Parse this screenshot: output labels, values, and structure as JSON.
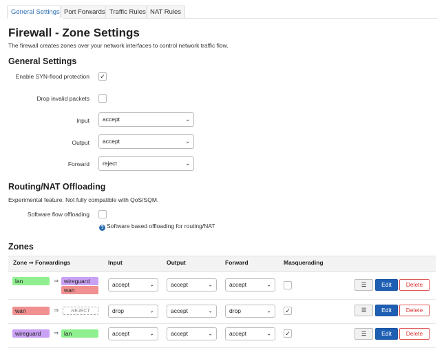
{
  "tabs": [
    {
      "label": "General Settings",
      "active": true
    },
    {
      "label": "Port Forwards",
      "active": false
    },
    {
      "label": "Traffic Rules",
      "active": false
    },
    {
      "label": "NAT Rules",
      "active": false
    }
  ],
  "title": "Firewall - Zone Settings",
  "description": "The firewall creates zones over your network interfaces to control network traffic flow.",
  "general": {
    "heading": "General Settings",
    "syn_label": "Enable SYN-flood protection",
    "syn_checked": true,
    "drop_label": "Drop invalid packets",
    "drop_checked": false,
    "input_label": "Input",
    "input_value": "accept",
    "output_label": "Output",
    "output_value": "accept",
    "forward_label": "Forward",
    "forward_value": "reject"
  },
  "offload": {
    "heading": "Routing/NAT Offloading",
    "desc": "Experimental feature. Not fully compatible with QoS/SQM.",
    "sw_label": "Software flow offloading",
    "sw_checked": false,
    "help": "Software based offloading for routing/NAT"
  },
  "zones": {
    "heading": "Zones",
    "headers": {
      "zone": "Zone ⇒ Forwardings",
      "input": "Input",
      "output": "Output",
      "forward": "Forward",
      "masq": "Masquerading"
    },
    "arrow": "⇒",
    "menu_label": "☰",
    "edit_label": "Edit",
    "delete_label": "Delete",
    "reject_label": "REJECT",
    "rows": [
      {
        "zone": "lan",
        "zone_color": "#90f090",
        "dest": [
          "wireguard",
          "wan"
        ],
        "dest_colors": [
          "#c9a2f5",
          "#f09090"
        ],
        "input": "accept",
        "output": "accept",
        "forward": "accept",
        "masq": false
      },
      {
        "zone": "wan",
        "zone_color": "#f09090",
        "dest": [],
        "input": "drop",
        "output": "accept",
        "forward": "drop",
        "masq": true
      },
      {
        "zone": "wireguard",
        "zone_color": "#c9a2f5",
        "dest": [
          "lan"
        ],
        "dest_colors": [
          "#90f090"
        ],
        "input": "accept",
        "output": "accept",
        "forward": "accept",
        "masq": true
      }
    ]
  },
  "colors": {
    "accent": "#1e5fb4",
    "lan": "#90f090",
    "wan": "#f09090",
    "wireguard": "#c9a2f5"
  }
}
